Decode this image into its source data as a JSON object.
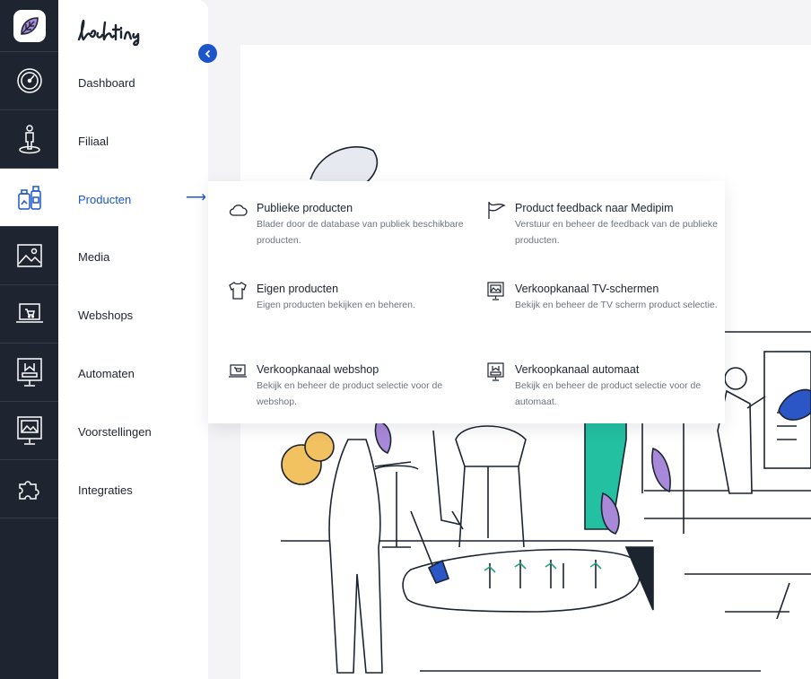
{
  "brand": {
    "name": "lochting",
    "accent": "#1b55c9",
    "rail_bg": "#1e2530"
  },
  "rail": [
    {
      "name": "dashboard",
      "icon": "speedometer-icon"
    },
    {
      "name": "filiaal",
      "icon": "person-location-icon"
    },
    {
      "name": "producten",
      "icon": "product-bottles-icon",
      "active": true
    },
    {
      "name": "media",
      "icon": "image-icon"
    },
    {
      "name": "webshops",
      "icon": "laptop-cart-icon"
    },
    {
      "name": "automaten",
      "icon": "vending-monitor-icon"
    },
    {
      "name": "voorstellingen",
      "icon": "presentation-icon"
    },
    {
      "name": "integraties",
      "icon": "puzzle-icon"
    }
  ],
  "nav": {
    "items": [
      {
        "label": "Dashboard"
      },
      {
        "label": "Filiaal"
      },
      {
        "label": "Producten",
        "active": true
      },
      {
        "label": "Media"
      },
      {
        "label": "Webshops"
      },
      {
        "label": "Automaten"
      },
      {
        "label": "Voorstellingen"
      },
      {
        "label": "Integraties"
      }
    ],
    "active_arrow": "⟶",
    "collapse_icon": "chevron-left-icon"
  },
  "menu": {
    "items": [
      {
        "title": "Publieke producten",
        "desc": "Blader door de database van publiek beschikbare producten.",
        "icon": "cloud-icon"
      },
      {
        "title": "Product feedback naar Medipim",
        "desc": "Verstuur en beheer de feedback van de publieke producten.",
        "icon": "flag-icon"
      },
      {
        "title": "Eigen producten",
        "desc": "Eigen producten bekijken en beheren.",
        "icon": "tshirt-icon"
      },
      {
        "title": "Verkoopkanaal TV-schermen",
        "desc": "Bekijk en beheer de TV scherm product selectie.",
        "icon": "presentation-icon"
      },
      {
        "title": "Verkoopkanaal webshop",
        "desc": "Bekijk en beheer de product selectie voor de webshop.",
        "icon": "laptop-cart-icon"
      },
      {
        "title": "Verkoopkanaal automaat",
        "desc": "Bekijk en beheer de product selectie voor de automaat.",
        "icon": "vending-monitor-icon"
      }
    ]
  }
}
